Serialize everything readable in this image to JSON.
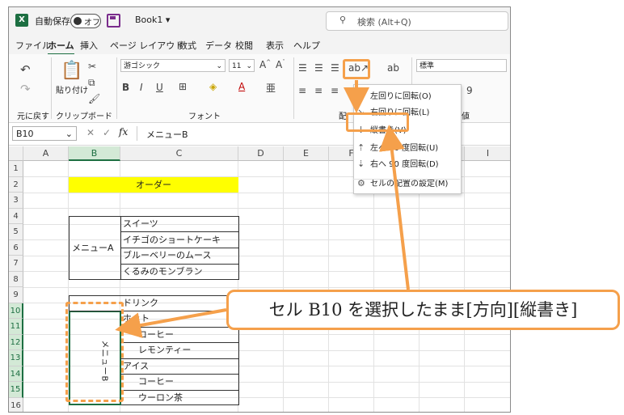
{
  "titlebar": {
    "logo": "X",
    "autosave_label": "自動保存",
    "autosave_state": "オフ",
    "workbook": "Book1",
    "search_placeholder": "検索 (Alt+Q)"
  },
  "menu_tabs": [
    "ファイル",
    "ホーム",
    "挿入",
    "ページ レイアウト",
    "数式",
    "データ",
    "校閲",
    "表示",
    "ヘルプ"
  ],
  "ribbon": {
    "undo_group": "元に戻す",
    "clipboard_group": "クリップボード",
    "paste_label": "貼り付け",
    "font_group": "フォント",
    "font_name": "游ゴシック",
    "font_size": "11",
    "alignment_group_prefix": "配",
    "number_group": "数値",
    "number_format": "標準"
  },
  "formula_bar": {
    "name_box": "B10",
    "fx": "fx",
    "content": "メニューB"
  },
  "columns": [
    "A",
    "B",
    "C",
    "D",
    "E",
    "F",
    "G",
    "H",
    "I"
  ],
  "rows": [
    "1",
    "2",
    "3",
    "4",
    "5",
    "6",
    "7",
    "8",
    "9",
    "10",
    "11",
    "12",
    "13",
    "14",
    "15",
    "16"
  ],
  "cells": {
    "c2": "オーダー",
    "c4": "スイーツ",
    "c5": "イチゴのショートケーキ",
    "c6": "ブルーベリーのムース",
    "c7": "くるみのモンブラン",
    "b5": "メニューA",
    "c9": "ドリンク",
    "c10": "ホット",
    "c11": "コーヒー",
    "c12": "レモンティー",
    "c13": "アイス",
    "c14": "コーヒー",
    "c15": "ウーロン茶",
    "b10": "メニューB"
  },
  "orientation_menu": [
    {
      "icon": "rotate-ccw-icon",
      "label": "左回りに回転(O)"
    },
    {
      "icon": "rotate-cw-icon",
      "label": "右回りに回転(L)"
    },
    {
      "icon": "vertical-text-icon",
      "label": "縦書き(V)"
    },
    {
      "icon": "rotate-up-icon",
      "label": "左へ 90 度回転(U)"
    },
    {
      "icon": "rotate-down-icon",
      "label": "右へ 90 度回転(D)"
    },
    {
      "icon": "format-alignment-icon",
      "label": "セルの配置の設定(M)"
    }
  ],
  "callout": "セル B10 を選択したまま[方向][縦書き]",
  "colors": {
    "excel_green": "#1d6f42",
    "highlight_yellow": "#ffff00",
    "annotation_orange": "#f5a04b"
  }
}
